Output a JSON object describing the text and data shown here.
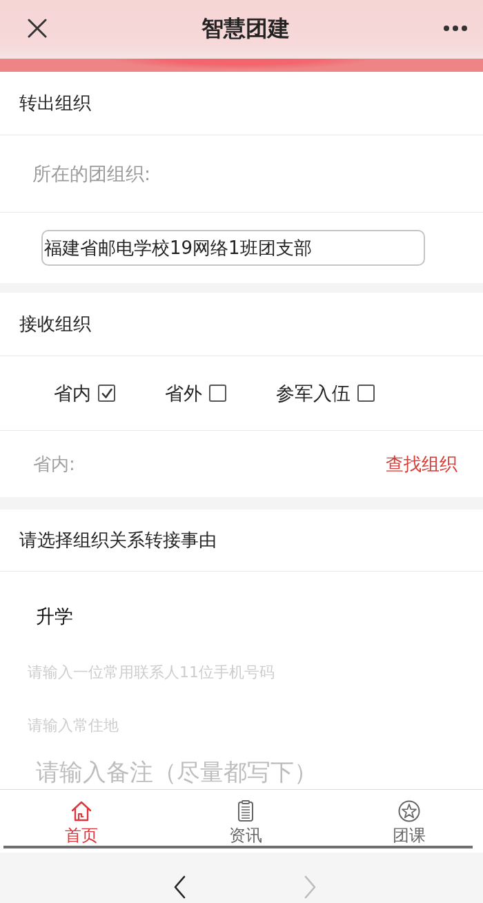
{
  "header": {
    "title": "智慧团建"
  },
  "transfer_out": {
    "heading": "转出组织",
    "label": "所在的团组织:",
    "organization": "福建省邮电学校19网络1班团支部"
  },
  "receive": {
    "heading": "接收组织",
    "options": [
      {
        "label": "省内",
        "checked": true
      },
      {
        "label": "省外",
        "checked": false
      },
      {
        "label": "参军入伍",
        "checked": false
      }
    ],
    "scope_label": "省内:",
    "find_link": "查找组织"
  },
  "reason": {
    "heading": "请选择组织关系转接事由",
    "selection": "升学",
    "fields": [
      {
        "kind": "line",
        "placeholder": "请输入一位常用联系人11位手机号码"
      },
      {
        "kind": "line",
        "placeholder": "请输入常住地"
      },
      {
        "kind": "area",
        "placeholder": "请输入备注（尽量都写下）"
      }
    ]
  },
  "tabs": [
    {
      "kind": "home",
      "label": "首页",
      "selected": true
    },
    {
      "kind": "news",
      "label": "资讯",
      "selected": false
    },
    {
      "kind": "course",
      "label": "团课",
      "selected": false
    }
  ],
  "browser_nav": [
    {
      "kind": "back",
      "disabled": false
    },
    {
      "kind": "forward",
      "disabled": true
    }
  ]
}
